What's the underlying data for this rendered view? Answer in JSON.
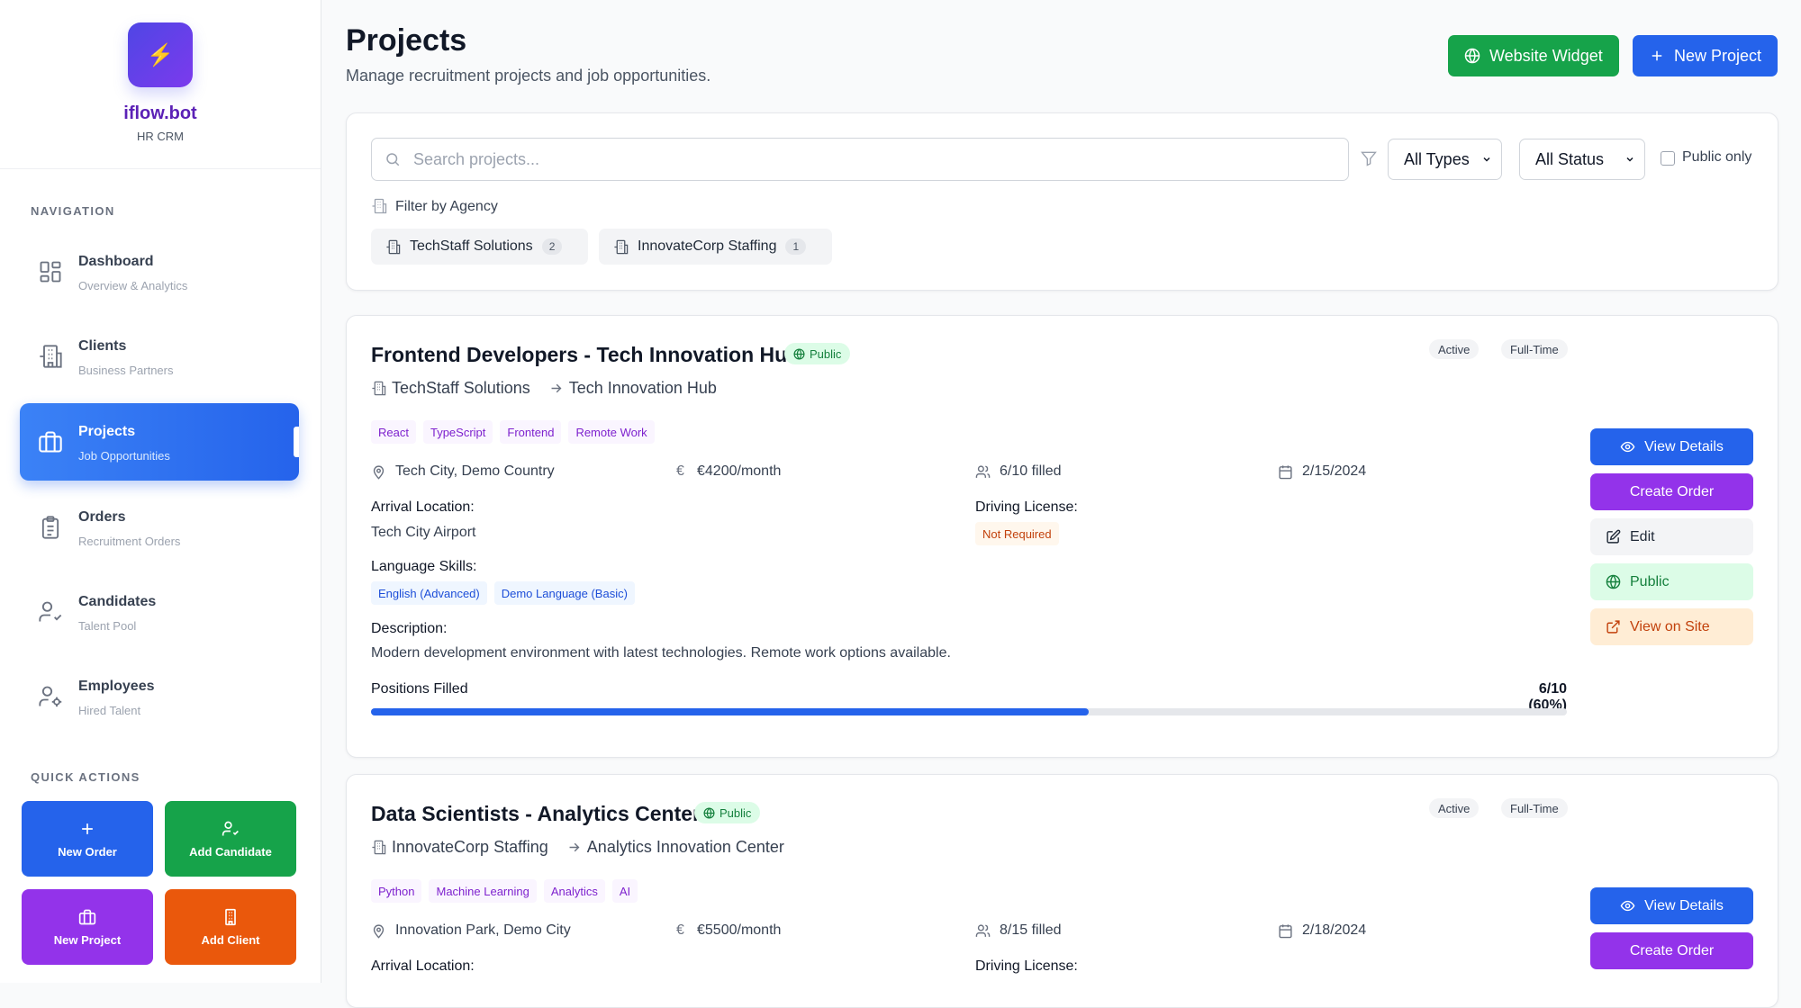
{
  "brand": {
    "name": "iflow.bot",
    "subtitle": "HR CRM"
  },
  "sidebar": {
    "nav_label": "NAVIGATION",
    "items": [
      {
        "title": "Dashboard",
        "subtitle": "Overview & Analytics",
        "icon": "dashboard-icon"
      },
      {
        "title": "Clients",
        "subtitle": "Business Partners",
        "icon": "building-icon"
      },
      {
        "title": "Projects",
        "subtitle": "Job Opportunities",
        "icon": "briefcase-icon",
        "active": true
      },
      {
        "title": "Orders",
        "subtitle": "Recruitment Orders",
        "icon": "clipboard-icon"
      },
      {
        "title": "Candidates",
        "subtitle": "Talent Pool",
        "icon": "user-check-icon"
      },
      {
        "title": "Employees",
        "subtitle": "Hired Talent",
        "icon": "user-cog-icon"
      }
    ],
    "quick_label": "QUICK ACTIONS",
    "quick_actions": [
      {
        "label": "New Order",
        "color": "#2563eb"
      },
      {
        "label": "Add Candidate",
        "color": "#16a34a"
      },
      {
        "label": "New Project",
        "color": "#9333ea"
      },
      {
        "label": "Add Client",
        "color": "#ea580c"
      }
    ]
  },
  "header": {
    "title": "Projects",
    "subtitle": "Manage recruitment projects and job opportunities.",
    "widget_button": "Website Widget",
    "new_project_button": "New Project"
  },
  "filters": {
    "search_placeholder": "Search projects...",
    "type_select": "All Types",
    "status_select": "All Status",
    "public_only": "Public only",
    "filter_by_agency": "Filter by Agency",
    "agencies": [
      {
        "name": "TechStaff Solutions",
        "count": "2"
      },
      {
        "name": "InnovateCorp Staffing",
        "count": "1"
      }
    ]
  },
  "projects": [
    {
      "title": "Frontend Developers - Tech Innovation Hub",
      "visibility": "Public",
      "status": "Active",
      "type": "Full-Time",
      "agency": "TechStaff Solutions",
      "client": "Tech Innovation Hub",
      "tags": [
        "React",
        "TypeScript",
        "Frontend",
        "Remote Work"
      ],
      "location": "Tech City, Demo Country",
      "salary": "€4200/month",
      "filled": "6/10 filled",
      "date": "2/15/2024",
      "arrival_label": "Arrival Location:",
      "arrival_value": "Tech City Airport",
      "license_label": "Driving License:",
      "license_value": "Not Required",
      "language_label": "Language Skills:",
      "languages": [
        "English (Advanced)",
        "Demo Language (Basic)"
      ],
      "description_label": "Description:",
      "description": "Modern development environment with latest technologies. Remote work options available.",
      "progress_label": "Positions Filled",
      "progress_text": "6/10 (60%)",
      "progress_fraction": 0.6,
      "actions": {
        "view": "View Details",
        "order": "Create Order",
        "edit": "Edit",
        "public": "Public",
        "site": "View on Site"
      }
    },
    {
      "title": "Data Scientists - Analytics Center",
      "visibility": "Public",
      "status": "Active",
      "type": "Full-Time",
      "agency": "InnovateCorp Staffing",
      "client": "Analytics Innovation Center",
      "tags": [
        "Python",
        "Machine Learning",
        "Analytics",
        "AI"
      ],
      "location": "Innovation Park, Demo City",
      "salary": "€5500/month",
      "filled": "8/15 filled",
      "date": "2/18/2024",
      "arrival_label": "Arrival Location:",
      "license_label": "Driving License:",
      "actions": {
        "view": "View Details",
        "order": "Create Order"
      }
    }
  ]
}
